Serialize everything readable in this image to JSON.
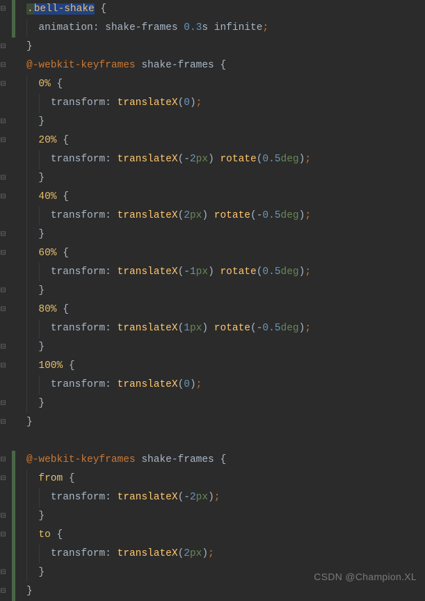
{
  "watermark": "CSDN @Champion.XL",
  "code": {
    "lines": [
      {
        "indent": 0,
        "tokens": [
          {
            "t": ".",
            "c": "c-sel"
          },
          {
            "t": "bell-shake",
            "c": "c-sel",
            "selected": true
          },
          {
            "t": " {",
            "c": "c-brace"
          }
        ],
        "fold": "open",
        "changebar": true,
        "hl_first_token": true
      },
      {
        "indent": 1,
        "tokens": [
          {
            "t": "animation",
            "c": "c-prop"
          },
          {
            "t": ": ",
            "c": "c-punc"
          },
          {
            "t": "shake-frames ",
            "c": "c-prop"
          },
          {
            "t": "0.3",
            "c": "c-num"
          },
          {
            "t": "s ",
            "c": "c-prop"
          },
          {
            "t": "infinite",
            "c": "c-prop"
          },
          {
            "t": ";",
            "c": "c-semi"
          }
        ],
        "changebar": true
      },
      {
        "indent": 0,
        "tokens": [
          {
            "t": "}",
            "c": "c-brace"
          }
        ],
        "fold": "close"
      },
      {
        "indent": 0,
        "tokens": [
          {
            "t": "@-webkit-keyframes ",
            "c": "c-kw"
          },
          {
            "t": "shake-frames ",
            "c": "c-prop"
          },
          {
            "t": "{",
            "c": "c-brace"
          }
        ],
        "fold": "open"
      },
      {
        "indent": 1,
        "tokens": [
          {
            "t": "0% ",
            "c": "c-percent"
          },
          {
            "t": "{",
            "c": "c-brace"
          }
        ],
        "fold": "open"
      },
      {
        "indent": 2,
        "tokens": [
          {
            "t": "transform",
            "c": "c-prop"
          },
          {
            "t": ": ",
            "c": "c-punc"
          },
          {
            "t": "translateX",
            "c": "c-func"
          },
          {
            "t": "(",
            "c": "c-punc"
          },
          {
            "t": "0",
            "c": "c-num"
          },
          {
            "t": ")",
            "c": "c-punc"
          },
          {
            "t": ";",
            "c": "c-semi"
          }
        ]
      },
      {
        "indent": 1,
        "tokens": [
          {
            "t": "}",
            "c": "c-brace"
          }
        ],
        "fold": "close"
      },
      {
        "indent": 1,
        "tokens": [
          {
            "t": "20% ",
            "c": "c-percent"
          },
          {
            "t": "{",
            "c": "c-brace"
          }
        ],
        "fold": "open"
      },
      {
        "indent": 2,
        "tokens": [
          {
            "t": "transform",
            "c": "c-prop"
          },
          {
            "t": ": ",
            "c": "c-punc"
          },
          {
            "t": "translateX",
            "c": "c-func"
          },
          {
            "t": "(-",
            "c": "c-punc"
          },
          {
            "t": "2",
            "c": "c-num"
          },
          {
            "t": "px",
            "c": "c-unit"
          },
          {
            "t": ") ",
            "c": "c-punc"
          },
          {
            "t": "rotate",
            "c": "c-func"
          },
          {
            "t": "(",
            "c": "c-punc"
          },
          {
            "t": "0.5",
            "c": "c-num"
          },
          {
            "t": "deg",
            "c": "c-unit"
          },
          {
            "t": ")",
            "c": "c-punc"
          },
          {
            "t": ";",
            "c": "c-semi"
          }
        ]
      },
      {
        "indent": 1,
        "tokens": [
          {
            "t": "}",
            "c": "c-brace"
          }
        ],
        "fold": "close"
      },
      {
        "indent": 1,
        "tokens": [
          {
            "t": "40% ",
            "c": "c-percent"
          },
          {
            "t": "{",
            "c": "c-brace"
          }
        ],
        "fold": "open"
      },
      {
        "indent": 2,
        "tokens": [
          {
            "t": "transform",
            "c": "c-prop"
          },
          {
            "t": ": ",
            "c": "c-punc"
          },
          {
            "t": "translateX",
            "c": "c-func"
          },
          {
            "t": "(",
            "c": "c-punc"
          },
          {
            "t": "2",
            "c": "c-num"
          },
          {
            "t": "px",
            "c": "c-unit"
          },
          {
            "t": ") ",
            "c": "c-punc"
          },
          {
            "t": "rotate",
            "c": "c-func"
          },
          {
            "t": "(-",
            "c": "c-punc"
          },
          {
            "t": "0.5",
            "c": "c-num"
          },
          {
            "t": "deg",
            "c": "c-unit"
          },
          {
            "t": ")",
            "c": "c-punc"
          },
          {
            "t": ";",
            "c": "c-semi"
          }
        ]
      },
      {
        "indent": 1,
        "tokens": [
          {
            "t": "}",
            "c": "c-brace"
          }
        ],
        "fold": "close"
      },
      {
        "indent": 1,
        "tokens": [
          {
            "t": "60% ",
            "c": "c-percent"
          },
          {
            "t": "{",
            "c": "c-brace"
          }
        ],
        "fold": "open"
      },
      {
        "indent": 2,
        "tokens": [
          {
            "t": "transform",
            "c": "c-prop"
          },
          {
            "t": ": ",
            "c": "c-punc"
          },
          {
            "t": "translateX",
            "c": "c-func"
          },
          {
            "t": "(-",
            "c": "c-punc"
          },
          {
            "t": "1",
            "c": "c-num"
          },
          {
            "t": "px",
            "c": "c-unit"
          },
          {
            "t": ") ",
            "c": "c-punc"
          },
          {
            "t": "rotate",
            "c": "c-func"
          },
          {
            "t": "(",
            "c": "c-punc"
          },
          {
            "t": "0.5",
            "c": "c-num"
          },
          {
            "t": "deg",
            "c": "c-unit"
          },
          {
            "t": ")",
            "c": "c-punc"
          },
          {
            "t": ";",
            "c": "c-semi"
          }
        ]
      },
      {
        "indent": 1,
        "tokens": [
          {
            "t": "}",
            "c": "c-brace"
          }
        ],
        "fold": "close"
      },
      {
        "indent": 1,
        "tokens": [
          {
            "t": "80% ",
            "c": "c-percent"
          },
          {
            "t": "{",
            "c": "c-brace"
          }
        ],
        "fold": "open"
      },
      {
        "indent": 2,
        "tokens": [
          {
            "t": "transform",
            "c": "c-prop"
          },
          {
            "t": ": ",
            "c": "c-punc"
          },
          {
            "t": "translateX",
            "c": "c-func"
          },
          {
            "t": "(",
            "c": "c-punc"
          },
          {
            "t": "1",
            "c": "c-num"
          },
          {
            "t": "px",
            "c": "c-unit"
          },
          {
            "t": ") ",
            "c": "c-punc"
          },
          {
            "t": "rotate",
            "c": "c-func"
          },
          {
            "t": "(-",
            "c": "c-punc"
          },
          {
            "t": "0.5",
            "c": "c-num"
          },
          {
            "t": "deg",
            "c": "c-unit"
          },
          {
            "t": ")",
            "c": "c-punc"
          },
          {
            "t": ";",
            "c": "c-semi"
          }
        ]
      },
      {
        "indent": 1,
        "tokens": [
          {
            "t": "}",
            "c": "c-brace"
          }
        ],
        "fold": "close"
      },
      {
        "indent": 1,
        "tokens": [
          {
            "t": "100% ",
            "c": "c-percent"
          },
          {
            "t": "{",
            "c": "c-brace"
          }
        ],
        "fold": "open"
      },
      {
        "indent": 2,
        "tokens": [
          {
            "t": "transform",
            "c": "c-prop"
          },
          {
            "t": ": ",
            "c": "c-punc"
          },
          {
            "t": "translateX",
            "c": "c-func"
          },
          {
            "t": "(",
            "c": "c-punc"
          },
          {
            "t": "0",
            "c": "c-num"
          },
          {
            "t": ")",
            "c": "c-punc"
          },
          {
            "t": ";",
            "c": "c-semi"
          }
        ]
      },
      {
        "indent": 1,
        "tokens": [
          {
            "t": "}",
            "c": "c-brace"
          }
        ],
        "fold": "close"
      },
      {
        "indent": 0,
        "tokens": [
          {
            "t": "}",
            "c": "c-brace"
          }
        ],
        "fold": "close"
      },
      {
        "indent": 0,
        "tokens": [],
        "blank": true
      },
      {
        "indent": 0,
        "tokens": [
          {
            "t": "@-webkit-keyframes ",
            "c": "c-kw"
          },
          {
            "t": "shake-frames ",
            "c": "c-prop"
          },
          {
            "t": "{",
            "c": "c-brace"
          }
        ],
        "fold": "open",
        "changebar": true
      },
      {
        "indent": 1,
        "tokens": [
          {
            "t": "from ",
            "c": "c-percent"
          },
          {
            "t": "{",
            "c": "c-brace"
          }
        ],
        "fold": "open",
        "changebar": true
      },
      {
        "indent": 2,
        "tokens": [
          {
            "t": "transform",
            "c": "c-prop"
          },
          {
            "t": ": ",
            "c": "c-punc"
          },
          {
            "t": "translateX",
            "c": "c-func"
          },
          {
            "t": "(-",
            "c": "c-punc"
          },
          {
            "t": "2",
            "c": "c-num"
          },
          {
            "t": "px",
            "c": "c-unit"
          },
          {
            "t": ")",
            "c": "c-punc"
          },
          {
            "t": ";",
            "c": "c-semi"
          }
        ],
        "changebar": true
      },
      {
        "indent": 1,
        "tokens": [
          {
            "t": "}",
            "c": "c-brace"
          }
        ],
        "fold": "close",
        "changebar": true
      },
      {
        "indent": 1,
        "tokens": [
          {
            "t": "to ",
            "c": "c-percent"
          },
          {
            "t": "{",
            "c": "c-brace"
          }
        ],
        "fold": "open",
        "changebar": true
      },
      {
        "indent": 2,
        "tokens": [
          {
            "t": "transform",
            "c": "c-prop"
          },
          {
            "t": ": ",
            "c": "c-punc"
          },
          {
            "t": "translateX",
            "c": "c-func"
          },
          {
            "t": "(",
            "c": "c-punc"
          },
          {
            "t": "2",
            "c": "c-num"
          },
          {
            "t": "px",
            "c": "c-unit"
          },
          {
            "t": ")",
            "c": "c-punc"
          },
          {
            "t": ";",
            "c": "c-semi"
          }
        ],
        "changebar": true
      },
      {
        "indent": 1,
        "tokens": [
          {
            "t": "}",
            "c": "c-brace"
          }
        ],
        "fold": "close",
        "changebar": true
      },
      {
        "indent": 0,
        "tokens": [
          {
            "t": "}",
            "c": "c-brace"
          }
        ],
        "fold": "close",
        "changebar": true
      }
    ]
  }
}
